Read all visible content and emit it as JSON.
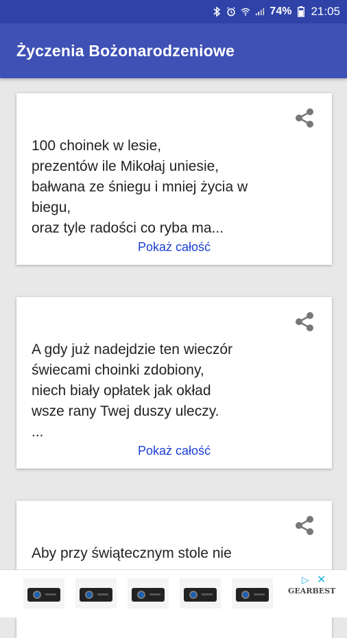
{
  "status_bar": {
    "battery": "74%",
    "time": "21:05"
  },
  "app_bar": {
    "title": "Życzenia Bożonarodzeniowe"
  },
  "cards": [
    {
      "text": "100 choinek w lesie,\nprezentów ile Mikołaj uniesie,\nbałwana ze śniegu i mniej życia w\nbiegu,\noraz tyle radości co ryba ma...",
      "show_more": "Pokaż całość"
    },
    {
      "text": "A gdy już nadejdzie ten wieczór\nświecami choinki zdobiony,\nniech biały opłatek jak okład\nwsze rany Twej duszy uleczy.\n...",
      "show_more": "Pokaż całość"
    },
    {
      "text": "Aby przy świątecznym stole nie"
    }
  ],
  "ad": {
    "brand": "GEARBEST",
    "choice_icon": "ad-choices-icon",
    "close_icon": "close-icon"
  },
  "colors": {
    "app_bar": "#3f51b5",
    "status_bar": "#2f42a8",
    "link": "#1a3fd6",
    "share_icon": "#777777"
  }
}
